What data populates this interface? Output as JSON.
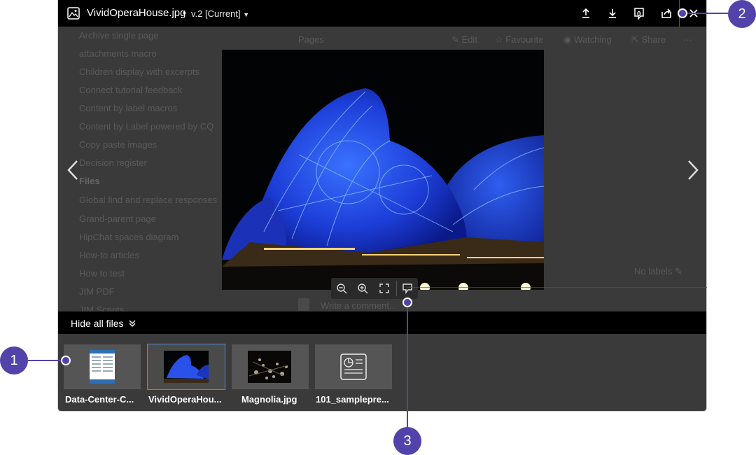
{
  "header": {
    "filename": "VividOperaHouse.jpg",
    "separator": "•",
    "version": "v.2 [Current]",
    "comment_count": "0"
  },
  "background_page": {
    "sidebar_items": [
      "Archive single page",
      "attachments macro",
      "Children display with excerpts",
      "Connect tutorial feedback",
      "Content by label macros",
      "Content by Label powered by CQ",
      "Copy paste images",
      "Decision register"
    ],
    "files_heading": "Files",
    "sidebar_items_2": [
      "Global find and replace responses",
      "Grand-parent page",
      "HipChat spaces diagram",
      "How-to articles",
      "How to test",
      "JIM PDF",
      "JIM Scripts"
    ],
    "breadcrumb": "Pages",
    "actions": {
      "edit": "Edit",
      "favourite": "Favourite",
      "watching": "Watching",
      "share": "Share",
      "more": "···"
    },
    "no_labels": "No labels",
    "comment_placeholder": "Write a comment..."
  },
  "files_bar": {
    "label": "Hide all files"
  },
  "thumbnails": [
    {
      "label": "Data-Center-C..."
    },
    {
      "label": "VividOperaHou..."
    },
    {
      "label": "Magnolia.jpg"
    },
    {
      "label": "101_samplepre..."
    }
  ],
  "callouts": [
    "1",
    "2",
    "3"
  ],
  "colors": {
    "callout": "#5243aa",
    "selected_outline": "#4a90d9",
    "topbar": "#000000",
    "overlay": "#3a3a3a"
  }
}
